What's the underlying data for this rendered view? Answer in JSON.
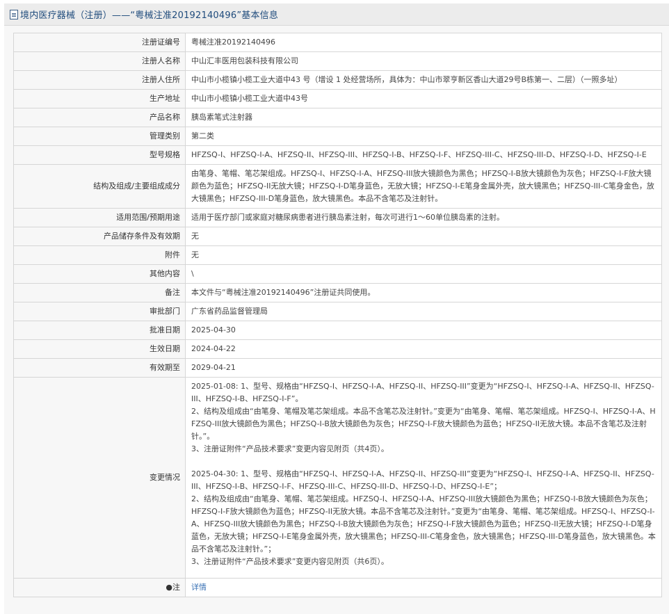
{
  "header": {
    "title": "境内医疗器械（注册）——“粤械注准20192140496”基本信息"
  },
  "rows": [
    {
      "label": "注册证编号",
      "value": "粤械注准20192140496"
    },
    {
      "label": "注册人名称",
      "value": "中山汇丰医用包装科技有限公司"
    },
    {
      "label": "注册人住所",
      "value": "中山市小榄镇小榄工业大道中43 号（增设 1 处经营场所，具体为：中山市翠亨新区香山大道29号B栋第一、二层）（一照多址）"
    },
    {
      "label": "生产地址",
      "value": "中山市小榄镇小榄工业大道中43号"
    },
    {
      "label": "产品名称",
      "value": "胰岛素笔式注射器"
    },
    {
      "label": "管理类别",
      "value": "第二类"
    },
    {
      "label": "型号规格",
      "value": "HFZSQ-I、HFZSQ-I-A、HFZSQ-II、HFZSQ-III、HFZSQ-I-B、HFZSQ-I-F、HFZSQ-III-C、HFZSQ-III-D、HFZSQ-I-D、HFZSQ-I-E"
    },
    {
      "label": "结构及组成/主要组成成分",
      "value": "由笔身、笔帽、笔芯架组成。HFZSQ-I、HFZSQ-I-A、HFZSQ-III放大镜颜色为黑色；HFZSQ-I-B放大镜颜色为灰色；HFZSQ-I-F放大镜颜色为蓝色；HFZSQ-II无放大镜；HFZSQ-I-D笔身蓝色，无放大镜；HFZSQ-I-E笔身金属外壳，放大镜黑色；HFZSQ-III-C笔身金色，放大镜黑色；HFZSQ-III-D笔身蓝色，放大镜黑色。本品不含笔芯及注射针。"
    },
    {
      "label": "适用范围/预期用途",
      "value": "适用于医疗部门或家庭对糖尿病患者进行胰岛素注射，每次可进行1～60单位胰岛素的注射。"
    },
    {
      "label": "产品储存条件及有效期",
      "value": "无"
    },
    {
      "label": "附件",
      "value": "无"
    },
    {
      "label": "其他内容",
      "value": "\\"
    },
    {
      "label": "备注",
      "value": "本文件与“粤械注准20192140496”注册证共同使用。"
    },
    {
      "label": "审批部门",
      "value": "广东省药品监督管理局"
    },
    {
      "label": "批准日期",
      "value": "2025-04-30"
    },
    {
      "label": "生效日期",
      "value": "2024-04-22"
    },
    {
      "label": "有效期至",
      "value": "2029-04-21"
    }
  ],
  "changes": {
    "label": "变更情况",
    "text": "2025-01-08: 1、型号、规格由“HFZSQ-I、HFZSQ-I-A、HFZSQ-II、HFZSQ-III”变更为“HFZSQ-I、HFZSQ-I-A、HFZSQ-II、HFZSQ-III、HFZSQ-I-B、HFZSQ-I-F”。\n2、结构及组成由“由笔身、笔帽及笔芯架组成。本品不含笔芯及注射针。”变更为“由笔身、笔帽、笔芯架组成。HFZSQ-I、HFZSQ-I-A、HFZSQ-III放大镜颜色为黑色；HFZSQ-I-B放大镜颜色为灰色；HFZSQ-I-F放大镜颜色为蓝色；HFZSQ-II无放大镜。本品不含笔芯及注射针。”。\n3、注册证附件“产品技术要求”变更内容见附页（共4页）。\n\n2025-04-30: 1、型号、规格由“HFZSQ-I、HFZSQ-I-A、HFZSQ-II、HFZSQ-III”变更为“HFZSQ-I、HFZSQ-I-A、HFZSQ-II、HFZSQ-III、HFZSQ-I-B、HFZSQ-I-F、HFZSQ-III-C、HFZSQ-III-D、HFZSQ-I-D、HFZSQ-I-E”；\n2、结构及组成由“由笔身、笔帽、笔芯架组成。HFZSQ-I、HFZSQ-I-A、HFZSQ-III放大镜颜色为黑色；HFZSQ-I-B放大镜颜色为灰色；HFZSQ-I-F放大镜颜色为蓝色；HFZSQ-II无放大镜。本品不含笔芯及注射针。”变更为“由笔身、笔帽、笔芯架组成。HFZSQ-I、HFZSQ-I-A、HFZSQ-III放大镜颜色为黑色；HFZSQ-I-B放大镜颜色为灰色；HFZSQ-I-F放大镜颜色为蓝色；HFZSQ-II无放大镜；HFZSQ-I-D笔身蓝色，无放大镜；HFZSQ-I-E笔身金属外壳，放大镜黑色；HFZSQ-III-C笔身金色，放大镜黑色；HFZSQ-III-D笔身蓝色，放大镜黑色。本品不含笔芯及注射针。”；\n3、注册证附件“产品技术要求”变更内容见附页（共6页）。"
  },
  "footer_row": {
    "label": "●注",
    "link": "详情"
  },
  "colors": {
    "title_text": "#1f4b7c",
    "label_bg": "#f7f7f7",
    "border": "#d6d6d6",
    "link": "#3a72b5"
  }
}
